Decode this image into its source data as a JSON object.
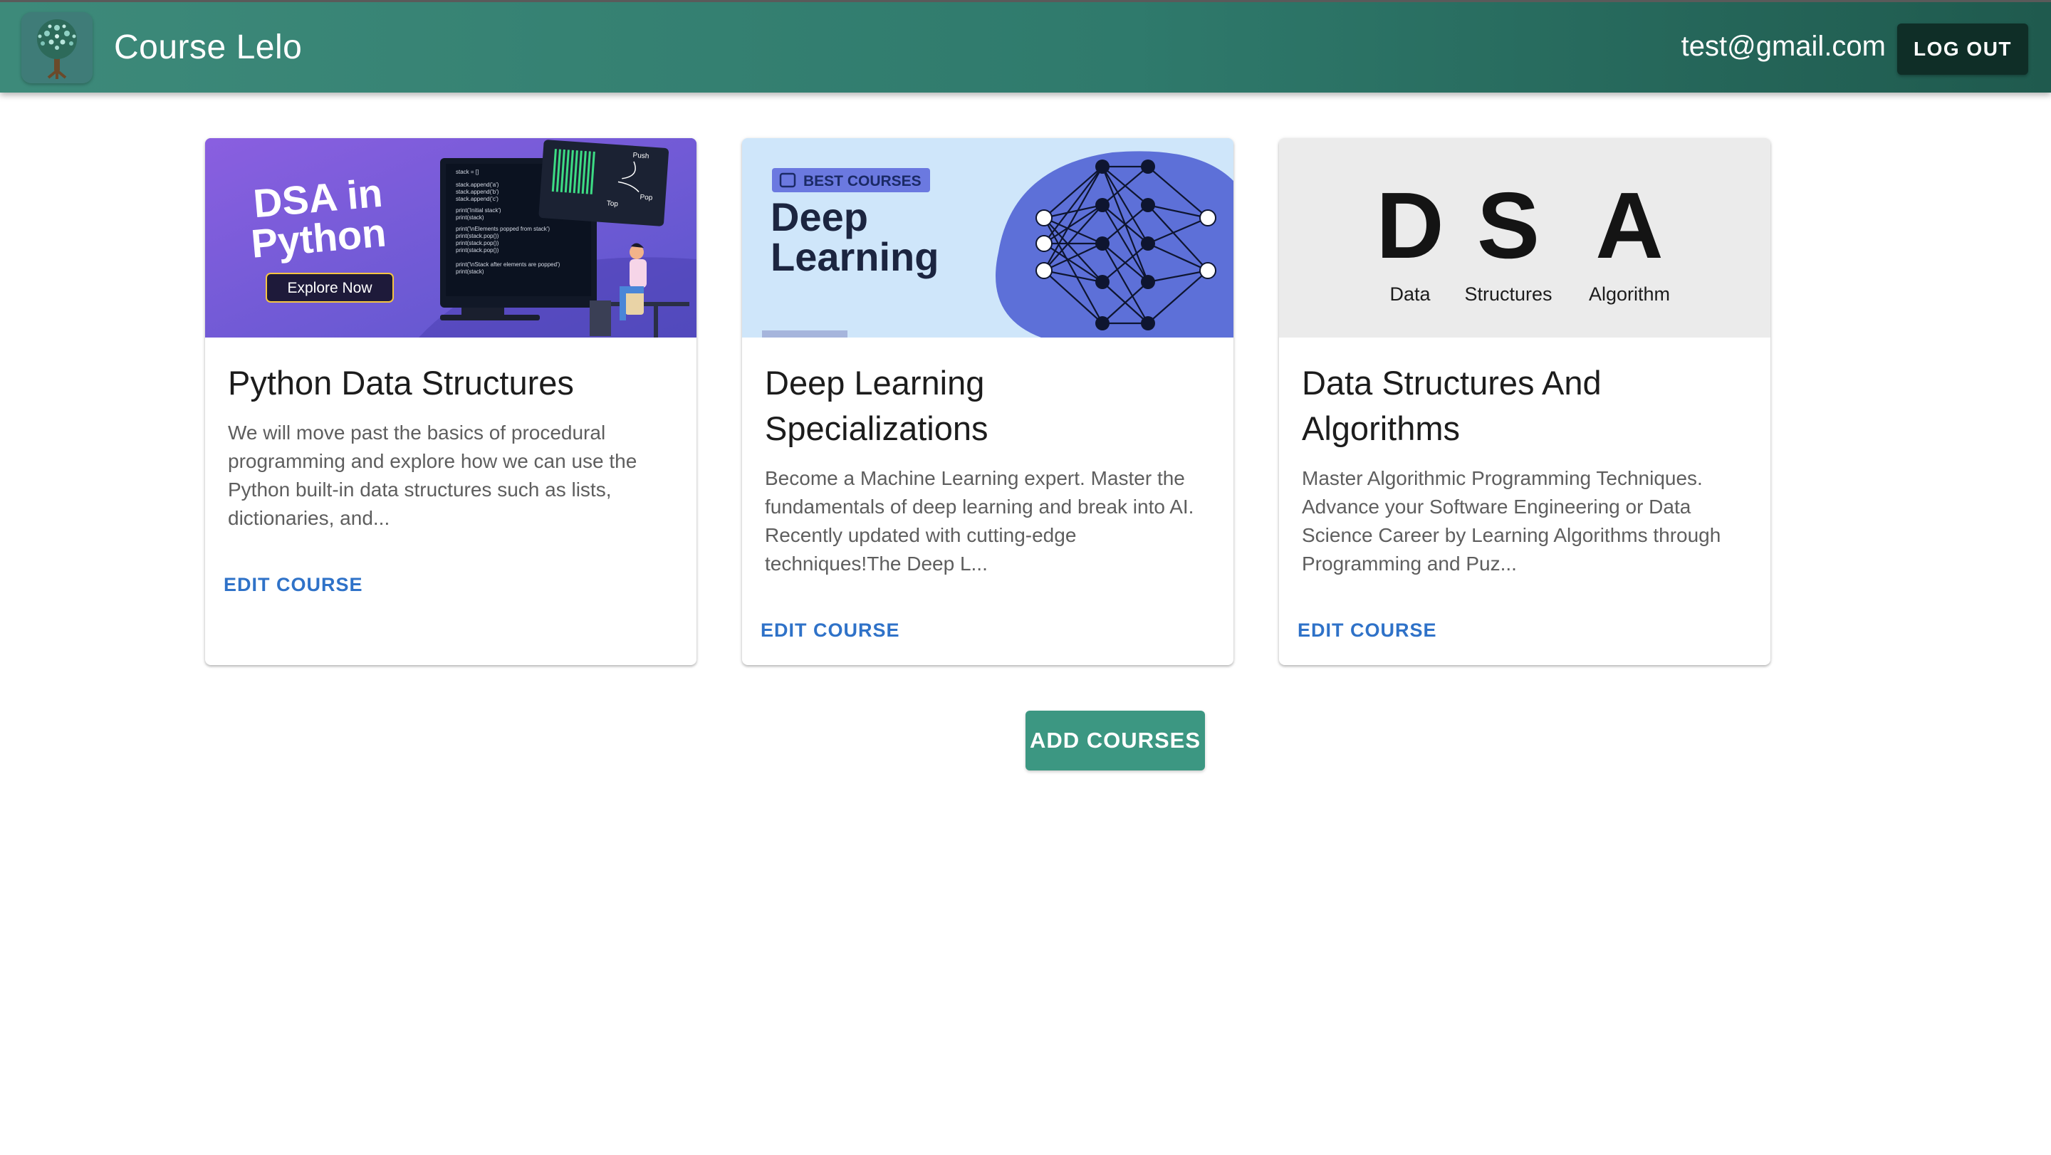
{
  "app": {
    "title": "Course Lelo",
    "logo_icon": "tree-logo-icon",
    "user_email": "test@gmail.com",
    "logout_label": "LOG OUT"
  },
  "colors": {
    "appbar": "#2f7a6c",
    "logout_bg": "#0f2e27",
    "accent_link": "#2f72c8",
    "add_button": "#3c9782"
  },
  "courses": [
    {
      "title": "Python Data Structures",
      "description": "We will move past the basics of procedural programming and explore how we can use the Python built-in data structures such as lists, dictionaries, and...",
      "edit_label": "EDIT COURSE",
      "image": {
        "headline_1": "DSA in",
        "headline_2": "Python",
        "cta": "Explore Now",
        "push": "Push",
        "pop": "Pop",
        "top": "Top"
      }
    },
    {
      "title": "Deep Learning Specializations",
      "description": "Become a Machine Learning expert. Master the fundamentals of deep learning and break into AI. Recently updated with cutting-edge techniques!The Deep L...",
      "edit_label": "EDIT COURSE",
      "image": {
        "badge": "BEST COURSES",
        "headline_1": "Deep",
        "headline_2": "Learning"
      }
    },
    {
      "title": "Data Structures And Algorithms",
      "description": "Master Algorithmic Programming Techniques. Advance your Software Engineering or Data Science Career by Learning Algorithms through Programming and Puz...",
      "edit_label": "EDIT COURSE",
      "image": {
        "letters": [
          "D",
          "S",
          "A"
        ],
        "words": [
          "Data",
          "Structures",
          "Algorithm"
        ]
      }
    }
  ],
  "add_courses_label": "ADD COURSES"
}
